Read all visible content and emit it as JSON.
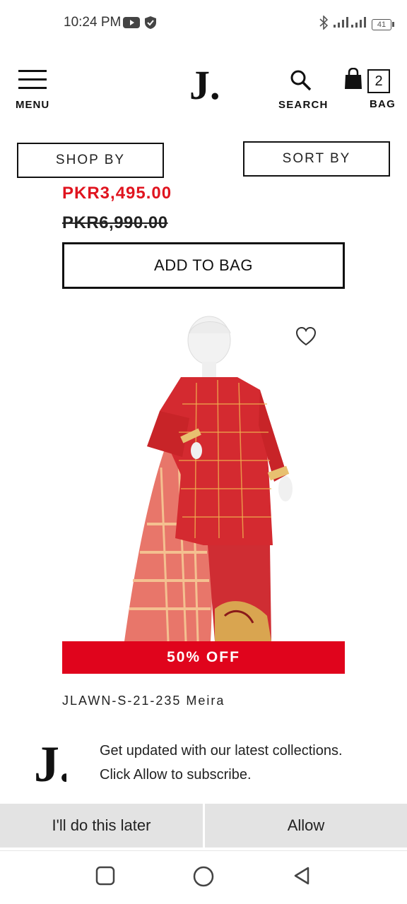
{
  "status_bar": {
    "time": "10:24 PM",
    "battery": "41"
  },
  "header": {
    "menu_label": "MENU",
    "logo_text": "J.",
    "search_label": "SEARCH",
    "bag_label": "BAG",
    "bag_count": "2"
  },
  "filters": {
    "shop_by": "SHOP BY",
    "sort_by": "SORT BY"
  },
  "previous_product": {
    "sale_price": "PKR3,495.00",
    "original_price": "PKR6,990.00",
    "add_to_bag": "ADD TO BAG"
  },
  "product": {
    "discount": "50% OFF",
    "name": "JLAWN-S-21-235 Meira"
  },
  "subscribe_prompt": {
    "logo_text": "J.",
    "line1": "Get updated with our latest collections.",
    "line2": "Click Allow to subscribe.",
    "later_label": "I'll do this later",
    "allow_label": "Allow"
  },
  "colors": {
    "accent_red": "#e0041c",
    "text": "#111111"
  },
  "icons": [
    "youtube-icon",
    "shield-icon",
    "bluetooth-icon",
    "signal-icon",
    "battery-icon",
    "hamburger-icon",
    "search-icon",
    "shopping-bag-icon",
    "heart-icon",
    "square-icon",
    "circle-icon",
    "back-triangle-icon"
  ]
}
